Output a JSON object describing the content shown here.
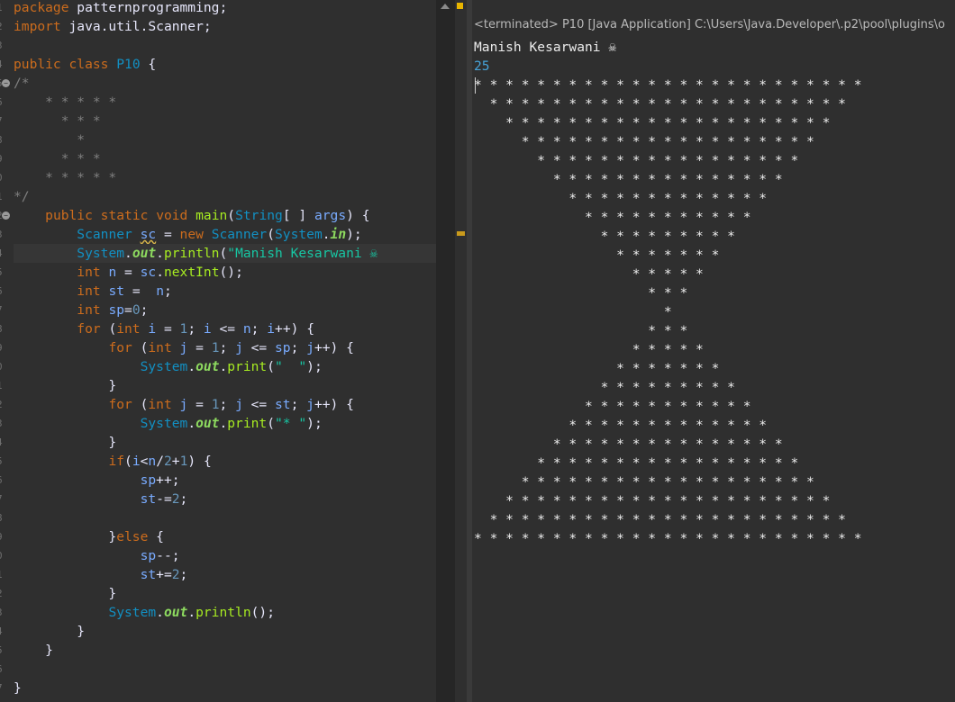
{
  "editor": {
    "lines": [
      [
        {
          "t": "package",
          "c": "kw"
        },
        {
          "t": " patternprogramming;",
          "c": "op"
        }
      ],
      [
        {
          "t": "import",
          "c": "kw"
        },
        {
          "t": " java.util.Scanner;",
          "c": "op"
        }
      ],
      [],
      [
        {
          "t": "public",
          "c": "kw"
        },
        {
          "t": " ",
          "c": "op"
        },
        {
          "t": "class",
          "c": "kw"
        },
        {
          "t": " ",
          "c": "op"
        },
        {
          "t": "P10",
          "c": "ty"
        },
        {
          "t": " {",
          "c": "op"
        }
      ],
      [
        {
          "t": "/*",
          "c": "cm"
        }
      ],
      [
        {
          "t": "    * * * * *",
          "c": "cm"
        }
      ],
      [
        {
          "t": "      * * *",
          "c": "cm"
        }
      ],
      [
        {
          "t": "        *",
          "c": "cm"
        }
      ],
      [
        {
          "t": "      * * *",
          "c": "cm"
        }
      ],
      [
        {
          "t": "    * * * * *",
          "c": "cm"
        }
      ],
      [
        {
          "t": "*/",
          "c": "cm"
        }
      ],
      [
        {
          "t": "    ",
          "c": "op"
        },
        {
          "t": "public",
          "c": "kw"
        },
        {
          "t": " ",
          "c": "op"
        },
        {
          "t": "static",
          "c": "kw"
        },
        {
          "t": " ",
          "c": "op"
        },
        {
          "t": "void",
          "c": "kw"
        },
        {
          "t": " ",
          "c": "op"
        },
        {
          "t": "main",
          "c": "fn"
        },
        {
          "t": "(",
          "c": "op"
        },
        {
          "t": "String",
          "c": "ty"
        },
        {
          "t": "[ ] ",
          "c": "op"
        },
        {
          "t": "args",
          "c": "var"
        },
        {
          "t": ") {",
          "c": "op"
        }
      ],
      [
        {
          "t": "        ",
          "c": "op"
        },
        {
          "t": "Scanner",
          "c": "ty"
        },
        {
          "t": " ",
          "c": "op"
        },
        {
          "t": "sc",
          "c": "var wavy"
        },
        {
          "t": " = ",
          "c": "op"
        },
        {
          "t": "new",
          "c": "kw"
        },
        {
          "t": " ",
          "c": "op"
        },
        {
          "t": "Scanner",
          "c": "ty"
        },
        {
          "t": "(",
          "c": "op"
        },
        {
          "t": "System",
          "c": "ty"
        },
        {
          "t": ".",
          "c": "op"
        },
        {
          "t": "in",
          "c": "st"
        },
        {
          "t": ");",
          "c": "op"
        }
      ],
      [
        {
          "t": "        ",
          "c": "op"
        },
        {
          "t": "System",
          "c": "ty"
        },
        {
          "t": ".",
          "c": "op"
        },
        {
          "t": "out",
          "c": "st"
        },
        {
          "t": ".",
          "c": "op"
        },
        {
          "t": "println",
          "c": "fn"
        },
        {
          "t": "(",
          "c": "op"
        },
        {
          "t": "\"Manish Kesarwani ☠",
          "c": "str"
        }
      ],
      [
        {
          "t": "        ",
          "c": "op"
        },
        {
          "t": "int",
          "c": "kw"
        },
        {
          "t": " ",
          "c": "op"
        },
        {
          "t": "n",
          "c": "var"
        },
        {
          "t": " = ",
          "c": "op"
        },
        {
          "t": "sc",
          "c": "var"
        },
        {
          "t": ".",
          "c": "op"
        },
        {
          "t": "nextInt",
          "c": "fn"
        },
        {
          "t": "();",
          "c": "op"
        }
      ],
      [
        {
          "t": "        ",
          "c": "op"
        },
        {
          "t": "int",
          "c": "kw"
        },
        {
          "t": " ",
          "c": "op"
        },
        {
          "t": "st",
          "c": "var"
        },
        {
          "t": " =  ",
          "c": "op"
        },
        {
          "t": "n",
          "c": "var"
        },
        {
          "t": ";",
          "c": "op"
        }
      ],
      [
        {
          "t": "        ",
          "c": "op"
        },
        {
          "t": "int",
          "c": "kw"
        },
        {
          "t": " ",
          "c": "op"
        },
        {
          "t": "sp",
          "c": "var"
        },
        {
          "t": "=",
          "c": "op"
        },
        {
          "t": "0",
          "c": "num"
        },
        {
          "t": ";",
          "c": "op"
        }
      ],
      [
        {
          "t": "        ",
          "c": "op"
        },
        {
          "t": "for",
          "c": "kw"
        },
        {
          "t": " (",
          "c": "op"
        },
        {
          "t": "int",
          "c": "kw"
        },
        {
          "t": " ",
          "c": "op"
        },
        {
          "t": "i",
          "c": "var"
        },
        {
          "t": " = ",
          "c": "op"
        },
        {
          "t": "1",
          "c": "num"
        },
        {
          "t": "; ",
          "c": "op"
        },
        {
          "t": "i",
          "c": "var"
        },
        {
          "t": " <= ",
          "c": "op"
        },
        {
          "t": "n",
          "c": "var"
        },
        {
          "t": "; ",
          "c": "op"
        },
        {
          "t": "i",
          "c": "var"
        },
        {
          "t": "++) {",
          "c": "op"
        }
      ],
      [
        {
          "t": "            ",
          "c": "op"
        },
        {
          "t": "for",
          "c": "kw"
        },
        {
          "t": " (",
          "c": "op"
        },
        {
          "t": "int",
          "c": "kw"
        },
        {
          "t": " ",
          "c": "op"
        },
        {
          "t": "j",
          "c": "var"
        },
        {
          "t": " = ",
          "c": "op"
        },
        {
          "t": "1",
          "c": "num"
        },
        {
          "t": "; ",
          "c": "op"
        },
        {
          "t": "j",
          "c": "var"
        },
        {
          "t": " <= ",
          "c": "op"
        },
        {
          "t": "sp",
          "c": "var"
        },
        {
          "t": "; ",
          "c": "op"
        },
        {
          "t": "j",
          "c": "var"
        },
        {
          "t": "++) {",
          "c": "op"
        }
      ],
      [
        {
          "t": "                ",
          "c": "op"
        },
        {
          "t": "System",
          "c": "ty"
        },
        {
          "t": ".",
          "c": "op"
        },
        {
          "t": "out",
          "c": "st"
        },
        {
          "t": ".",
          "c": "op"
        },
        {
          "t": "print",
          "c": "fn"
        },
        {
          "t": "(",
          "c": "op"
        },
        {
          "t": "\"  \"",
          "c": "str"
        },
        {
          "t": ");",
          "c": "op"
        }
      ],
      [
        {
          "t": "            }",
          "c": "op"
        }
      ],
      [
        {
          "t": "            ",
          "c": "op"
        },
        {
          "t": "for",
          "c": "kw"
        },
        {
          "t": " (",
          "c": "op"
        },
        {
          "t": "int",
          "c": "kw"
        },
        {
          "t": " ",
          "c": "op"
        },
        {
          "t": "j",
          "c": "var"
        },
        {
          "t": " = ",
          "c": "op"
        },
        {
          "t": "1",
          "c": "num"
        },
        {
          "t": "; ",
          "c": "op"
        },
        {
          "t": "j",
          "c": "var"
        },
        {
          "t": " <= ",
          "c": "op"
        },
        {
          "t": "st",
          "c": "var"
        },
        {
          "t": "; ",
          "c": "op"
        },
        {
          "t": "j",
          "c": "var"
        },
        {
          "t": "++) {",
          "c": "op"
        }
      ],
      [
        {
          "t": "                ",
          "c": "op"
        },
        {
          "t": "System",
          "c": "ty"
        },
        {
          "t": ".",
          "c": "op"
        },
        {
          "t": "out",
          "c": "st"
        },
        {
          "t": ".",
          "c": "op"
        },
        {
          "t": "print",
          "c": "fn"
        },
        {
          "t": "(",
          "c": "op"
        },
        {
          "t": "\"* \"",
          "c": "str"
        },
        {
          "t": ");",
          "c": "op"
        }
      ],
      [
        {
          "t": "            }",
          "c": "op"
        }
      ],
      [
        {
          "t": "            ",
          "c": "op"
        },
        {
          "t": "if",
          "c": "kw"
        },
        {
          "t": "(",
          "c": "op"
        },
        {
          "t": "i",
          "c": "var"
        },
        {
          "t": "<",
          "c": "op"
        },
        {
          "t": "n",
          "c": "var"
        },
        {
          "t": "/",
          "c": "op"
        },
        {
          "t": "2",
          "c": "num"
        },
        {
          "t": "+",
          "c": "op"
        },
        {
          "t": "1",
          "c": "num"
        },
        {
          "t": ") {",
          "c": "op"
        }
      ],
      [
        {
          "t": "                ",
          "c": "op"
        },
        {
          "t": "sp",
          "c": "var"
        },
        {
          "t": "++;",
          "c": "op"
        }
      ],
      [
        {
          "t": "                ",
          "c": "op"
        },
        {
          "t": "st",
          "c": "var"
        },
        {
          "t": "-=",
          "c": "op"
        },
        {
          "t": "2",
          "c": "num"
        },
        {
          "t": ";",
          "c": "op"
        }
      ],
      [],
      [
        {
          "t": "            }",
          "c": "op"
        },
        {
          "t": "else",
          "c": "kw"
        },
        {
          "t": " {",
          "c": "op"
        }
      ],
      [
        {
          "t": "                ",
          "c": "op"
        },
        {
          "t": "sp",
          "c": "var"
        },
        {
          "t": "--;",
          "c": "op"
        }
      ],
      [
        {
          "t": "                ",
          "c": "op"
        },
        {
          "t": "st",
          "c": "var"
        },
        {
          "t": "+=",
          "c": "op"
        },
        {
          "t": "2",
          "c": "num"
        },
        {
          "t": ";",
          "c": "op"
        }
      ],
      [
        {
          "t": "            }",
          "c": "op"
        }
      ],
      [
        {
          "t": "            ",
          "c": "op"
        },
        {
          "t": "System",
          "c": "ty"
        },
        {
          "t": ".",
          "c": "op"
        },
        {
          "t": "out",
          "c": "st"
        },
        {
          "t": ".",
          "c": "op"
        },
        {
          "t": "println",
          "c": "fn"
        },
        {
          "t": "();",
          "c": "op"
        }
      ],
      [
        {
          "t": "        }",
          "c": "op"
        }
      ],
      [
        {
          "t": "    }",
          "c": "op"
        }
      ],
      [],
      [
        {
          "t": "}",
          "c": "op"
        }
      ]
    ],
    "line_number_glyphs": [
      "1",
      "2",
      "3",
      "4",
      "5",
      "6",
      "7",
      "8",
      "9",
      "0",
      "1",
      "2",
      "3",
      "4",
      "5",
      "6",
      "7",
      "8",
      "9",
      "0",
      "1",
      "2",
      "3",
      "4",
      "5",
      "6",
      "7",
      "8",
      "9",
      "0",
      "1",
      "2",
      "3",
      "4",
      "5",
      "6",
      "7"
    ],
    "fold_markers": {
      "4": "−",
      "11": "−"
    },
    "current_line": 13
  },
  "console": {
    "header": "<terminated> P10 [Java Application] C:\\Users\\Java.Developer\\.p2\\pool\\plugins\\o",
    "name_line": "Manish Kesarwani ☠",
    "input_line": "25",
    "star_rows": [
      {
        "indent": 0,
        "stars": 25
      },
      {
        "indent": 1,
        "stars": 23
      },
      {
        "indent": 2,
        "stars": 21
      },
      {
        "indent": 3,
        "stars": 19
      },
      {
        "indent": 4,
        "stars": 17
      },
      {
        "indent": 5,
        "stars": 15
      },
      {
        "indent": 6,
        "stars": 13
      },
      {
        "indent": 7,
        "stars": 11
      },
      {
        "indent": 8,
        "stars": 9
      },
      {
        "indent": 9,
        "stars": 7
      },
      {
        "indent": 10,
        "stars": 5
      },
      {
        "indent": 11,
        "stars": 3
      },
      {
        "indent": 12,
        "stars": 1
      },
      {
        "indent": 11,
        "stars": 3
      },
      {
        "indent": 10,
        "stars": 5
      },
      {
        "indent": 9,
        "stars": 7
      },
      {
        "indent": 8,
        "stars": 9
      },
      {
        "indent": 7,
        "stars": 11
      },
      {
        "indent": 6,
        "stars": 13
      },
      {
        "indent": 5,
        "stars": 15
      },
      {
        "indent": 4,
        "stars": 17
      },
      {
        "indent": 3,
        "stars": 19
      },
      {
        "indent": 2,
        "stars": 21
      },
      {
        "indent": 1,
        "stars": 23
      },
      {
        "indent": 0,
        "stars": 25
      }
    ]
  }
}
